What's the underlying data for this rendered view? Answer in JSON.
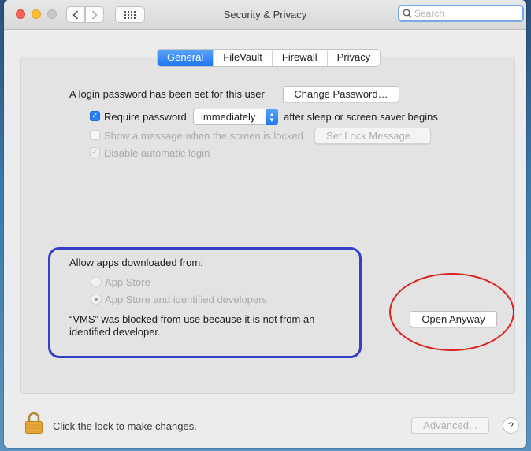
{
  "window": {
    "title": "Security & Privacy",
    "search_placeholder": "Search"
  },
  "tabs": [
    {
      "label": "General",
      "active": true
    },
    {
      "label": "FileVault",
      "active": false
    },
    {
      "label": "Firewall",
      "active": false
    },
    {
      "label": "Privacy",
      "active": false
    }
  ],
  "general": {
    "login_password_text": "A login password has been set for this user",
    "change_password_label": "Change Password…",
    "require_password_label": "Require password",
    "require_password_checked": true,
    "require_password_value": "immediately",
    "after_sleep_text": "after sleep or screen saver begins",
    "show_message_label": "Show a message when the screen is locked",
    "show_message_checked": false,
    "set_lock_message_label": "Set Lock Message...",
    "disable_auto_login_label": "Disable automatic login",
    "disable_auto_login_checked": true
  },
  "allow_apps": {
    "heading": "Allow apps downloaded from:",
    "options": [
      {
        "label": "App Store",
        "selected": false
      },
      {
        "label": "App Store and identified developers",
        "selected": true
      }
    ],
    "blocked_message_line1": "“VMS” was blocked from use because it is not from an",
    "blocked_message_line2": "identified developer.",
    "open_anyway_label": "Open Anyway"
  },
  "footer": {
    "lock_text": "Click the lock to make changes.",
    "advanced_label": "Advanced...",
    "help_label": "?"
  },
  "annotations": {
    "blue_box_color": "#3340c4",
    "red_oval_color": "#dc2020"
  }
}
